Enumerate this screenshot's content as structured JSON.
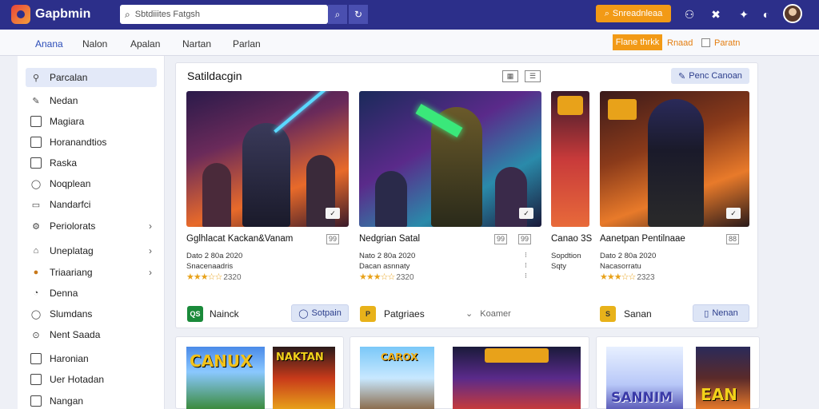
{
  "app": {
    "brand": "Gapbmin"
  },
  "search": {
    "placeholder": "Sbtdiiites Fatgsh"
  },
  "topbar": {
    "cta_label": "Snreadnleaa",
    "icons": [
      "user-icon",
      "puzzle-icon",
      "gift-icon",
      "moon-icon"
    ]
  },
  "nav": {
    "tabs": [
      {
        "label": "Anana",
        "active": true
      },
      {
        "label": "Nalon"
      },
      {
        "label": "Apalan"
      },
      {
        "label": "Nartan"
      },
      {
        "label": "Parlan"
      }
    ],
    "orange_button": "Flane thrkk",
    "orange_link": "Rnaad",
    "check_label": "Paratn"
  },
  "sidebar": {
    "items": [
      {
        "label": "Parcalan",
        "icon": "link-icon",
        "active": true
      },
      {
        "label": "Nedan",
        "icon": "edit-icon"
      },
      {
        "label": "Magiara",
        "icon": "list-icon"
      },
      {
        "label": "Horanandtios",
        "icon": "box-icon"
      },
      {
        "label": "Raska",
        "icon": "tag-icon"
      },
      {
        "label": "Noqplean",
        "icon": "circle-icon"
      },
      {
        "label": "Nandarfci",
        "icon": "book-icon"
      },
      {
        "label": "Periolorats",
        "icon": "gear-icon",
        "chevron": true
      },
      {
        "label": "Uneplatag",
        "icon": "home-icon",
        "chevron": true
      },
      {
        "label": "Triaariang",
        "icon": "badge-icon",
        "chevron": true
      },
      {
        "label": "Denna",
        "icon": "coin-icon"
      },
      {
        "label": "Slumdans",
        "icon": "chat-icon"
      },
      {
        "label": "Nent Saada",
        "icon": "pin-icon"
      },
      {
        "label": "Haronian",
        "icon": "grid-icon"
      },
      {
        "label": "Uer Hotadan",
        "icon": "square-icon"
      },
      {
        "label": "Nangan",
        "icon": "chart-icon"
      }
    ]
  },
  "panel": {
    "title": "Satildacgin",
    "button_label": "Penc Canoan",
    "cards": [
      {
        "title": "Gglhlacat Kackan&Vanam",
        "badge": "99",
        "meta1": "Dato 2 80a 2020",
        "meta2": "Snacenaadris",
        "rating": "2320",
        "stars": "★★★☆☆",
        "publisher": "Nainck",
        "publisher_logo": "QS",
        "action": "Sotpain"
      },
      {
        "title": "Nedgrian Satal",
        "badge": "99",
        "meta1": "Nato 2 80a 2020",
        "meta2": "Dacan asnnaty",
        "rating": "2320",
        "stars": "★★★☆☆",
        "publisher": "Patgriaes",
        "publisher_logo": "P",
        "action": "Koamer"
      },
      {
        "title": "Canao 3S",
        "meta1": "Sopdtion",
        "meta2": "Sqty"
      },
      {
        "title": "Aanetpan Pentilnaae",
        "badge": "88",
        "meta1": "Dato 2 80a 2020",
        "meta2": "Nacasorratu",
        "rating": "2323",
        "stars": "★★★☆☆",
        "publisher": "Sanan",
        "publisher_logo": "S",
        "action": "Nenan"
      }
    ]
  },
  "bottom": {
    "titles": [
      "CANUX",
      "NAKTAN",
      "CAROX",
      "SANNIM",
      "EAN"
    ]
  },
  "colors": {
    "topbar": "#2c2f8a",
    "accent": "#f29a16",
    "link": "#2c4db8"
  }
}
